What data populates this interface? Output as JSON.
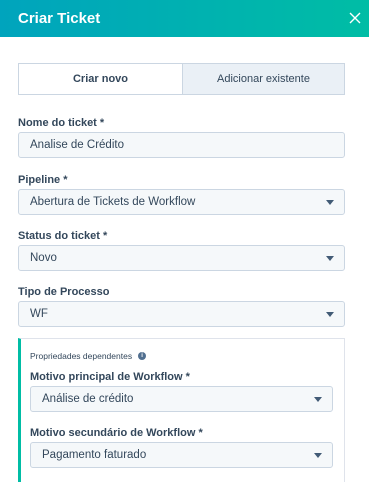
{
  "header": {
    "title": "Criar Ticket"
  },
  "tabs": [
    {
      "label": "Criar novo"
    },
    {
      "label": "Adicionar existente"
    }
  ],
  "fields": {
    "ticket_name": {
      "label": "Nome do ticket *",
      "value": "Analise de Crédito"
    },
    "pipeline": {
      "label": "Pipeline *",
      "value": "Abertura de Tickets de Workflow"
    },
    "status": {
      "label": "Status do ticket *",
      "value": "Novo"
    },
    "process_type": {
      "label": "Tipo de Processo",
      "value": "WF"
    }
  },
  "dependent": {
    "title": "Propriedades dependentes",
    "primary_reason": {
      "label": "Motivo principal de Workflow *",
      "value": "Análise de crédito"
    },
    "secondary_reason": {
      "label": "Motivo secundário de Workflow *",
      "value": "Pagamento faturado"
    }
  },
  "colors": {
    "header_start": "#00a4bd",
    "header_end": "#00bda5",
    "accent": "#00bda5"
  }
}
